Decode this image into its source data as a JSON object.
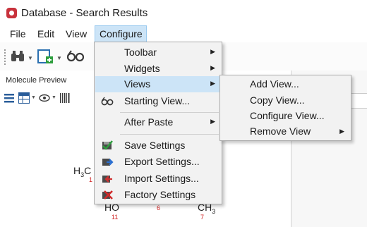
{
  "window": {
    "title": "Database - Search Results"
  },
  "menubar": {
    "items": [
      {
        "label": "File"
      },
      {
        "label": "Edit"
      },
      {
        "label": "View"
      },
      {
        "label": "Configure"
      }
    ]
  },
  "panel": {
    "title": "Molecule Preview"
  },
  "molecule": {
    "labels": [
      "H3C",
      "HO",
      "CH3"
    ],
    "atom_numbers": [
      "1",
      "11",
      "6",
      "7"
    ]
  },
  "configure_menu": {
    "items": [
      {
        "label": "Toolbar",
        "submenu": true
      },
      {
        "label": "Widgets",
        "submenu": true
      },
      {
        "label": "Views",
        "submenu": true,
        "highlighted": true
      },
      {
        "label": "Starting View...",
        "icon": "glasses-icon"
      },
      {
        "label": "After Paste",
        "submenu": true
      },
      {
        "label": "Save Settings",
        "icon": "save-settings-icon"
      },
      {
        "label": "Export Settings...",
        "icon": "export-settings-icon"
      },
      {
        "label": "Import Settings...",
        "icon": "import-settings-icon"
      },
      {
        "label": "Factory Settings",
        "icon": "factory-settings-icon"
      }
    ]
  },
  "views_submenu": {
    "items": [
      {
        "label": "Add View..."
      },
      {
        "label": "Copy View..."
      },
      {
        "label": "Configure View..."
      },
      {
        "label": "Remove View",
        "submenu": true
      }
    ]
  },
  "colors": {
    "highlight": "#cce4f7",
    "menu_bg": "#f2f2f2",
    "accent_red": "#c8323c"
  }
}
